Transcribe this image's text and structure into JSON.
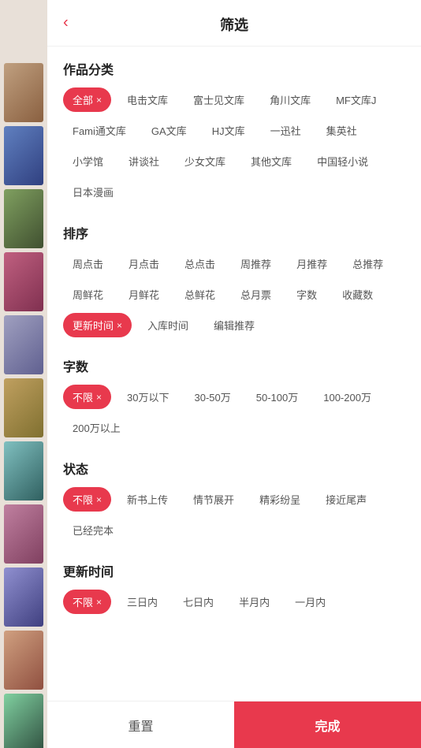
{
  "header": {
    "title": "筛选",
    "back_icon": "‹"
  },
  "sections": [
    {
      "id": "category",
      "title": "作品分类",
      "tags": [
        {
          "label": "全部",
          "active": true
        },
        {
          "label": "电击文库",
          "active": false
        },
        {
          "label": "富士见文库",
          "active": false
        },
        {
          "label": "角川文库",
          "active": false
        },
        {
          "label": "MF文库J",
          "active": false
        },
        {
          "label": "Fami通文库",
          "active": false
        },
        {
          "label": "GA文库",
          "active": false
        },
        {
          "label": "HJ文库",
          "active": false
        },
        {
          "label": "一迅社",
          "active": false
        },
        {
          "label": "集英社",
          "active": false
        },
        {
          "label": "小学馆",
          "active": false
        },
        {
          "label": "讲谈社",
          "active": false
        },
        {
          "label": "少女文库",
          "active": false
        },
        {
          "label": "其他文库",
          "active": false
        },
        {
          "label": "中国轻小说",
          "active": false
        },
        {
          "label": "日本漫画",
          "active": false
        }
      ]
    },
    {
      "id": "sort",
      "title": "排序",
      "tags": [
        {
          "label": "周点击",
          "active": false
        },
        {
          "label": "月点击",
          "active": false
        },
        {
          "label": "总点击",
          "active": false
        },
        {
          "label": "周推荐",
          "active": false
        },
        {
          "label": "月推荐",
          "active": false
        },
        {
          "label": "总推荐",
          "active": false
        },
        {
          "label": "周鲜花",
          "active": false
        },
        {
          "label": "月鲜花",
          "active": false
        },
        {
          "label": "总鲜花",
          "active": false
        },
        {
          "label": "总月票",
          "active": false
        },
        {
          "label": "字数",
          "active": false
        },
        {
          "label": "收藏数",
          "active": false
        },
        {
          "label": "更新时间",
          "active": true
        },
        {
          "label": "入库时间",
          "active": false
        },
        {
          "label": "编辑推荐",
          "active": false
        }
      ]
    },
    {
      "id": "wordcount",
      "title": "字数",
      "tags": [
        {
          "label": "不限",
          "active": true
        },
        {
          "label": "30万以下",
          "active": false
        },
        {
          "label": "30-50万",
          "active": false
        },
        {
          "label": "50-100万",
          "active": false
        },
        {
          "label": "100-200万",
          "active": false
        },
        {
          "label": "200万以上",
          "active": false
        }
      ]
    },
    {
      "id": "status",
      "title": "状态",
      "tags": [
        {
          "label": "不限",
          "active": true
        },
        {
          "label": "新书上传",
          "active": false
        },
        {
          "label": "情节展开",
          "active": false
        },
        {
          "label": "精彩纷呈",
          "active": false
        },
        {
          "label": "接近尾声",
          "active": false
        },
        {
          "label": "已经完本",
          "active": false
        }
      ]
    },
    {
      "id": "update_time",
      "title": "更新时间",
      "tags": [
        {
          "label": "不限",
          "active": true
        },
        {
          "label": "三日内",
          "active": false
        },
        {
          "label": "七日内",
          "active": false
        },
        {
          "label": "半月内",
          "active": false
        },
        {
          "label": "一月内",
          "active": false
        }
      ]
    }
  ],
  "footer": {
    "reset_label": "重置",
    "confirm_label": "完成"
  },
  "close_symbol": "×",
  "back_symbol": "‹"
}
